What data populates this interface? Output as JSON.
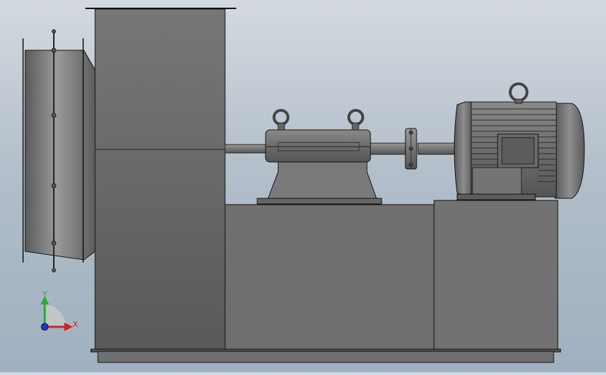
{
  "viewport": {
    "background_top": "#d4d9e0",
    "background_bottom": "#9fb0c0",
    "model_color": "#6e6e6e",
    "edge_color": "#111111"
  },
  "model": {
    "description_parts": [
      "fan-inlet-flange",
      "fan-scroll-housing",
      "shaft",
      "bearing-pedestal",
      "coupling",
      "electric-motor",
      "base-frame",
      "motor-base"
    ]
  },
  "triad": {
    "x_label": "X",
    "y_label": "Y",
    "x_color": "#cc2222",
    "y_color": "#2eaa2e",
    "z_color": "#2233cc"
  }
}
